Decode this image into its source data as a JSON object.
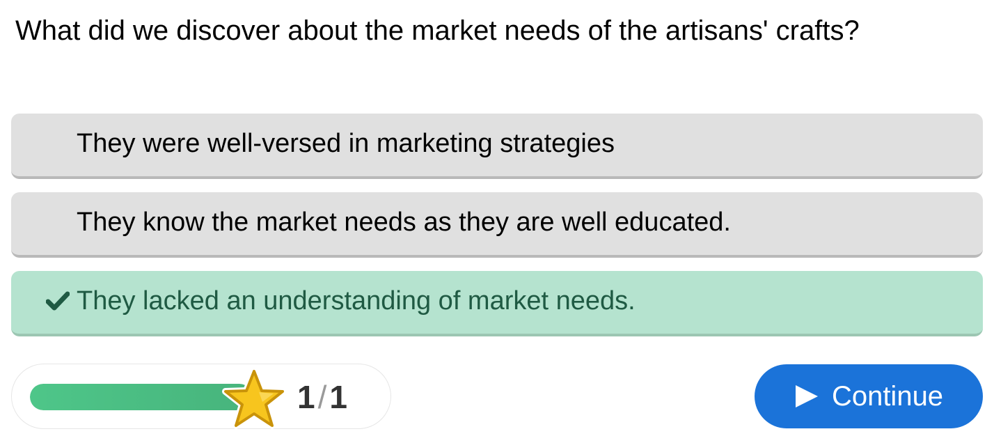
{
  "question": {
    "text": "What did we discover about the market needs of the artisans' crafts?"
  },
  "options": [
    {
      "label": "They were well-versed in marketing strategies",
      "state": "unselected"
    },
    {
      "label": "They know the market needs as they are well educated.",
      "state": "unselected"
    },
    {
      "label": "They lacked an understanding of market needs.",
      "state": "correct",
      "icon": "check-icon"
    }
  ],
  "progress": {
    "current": "1",
    "separator": "/",
    "total": "1",
    "fill_fraction": 1.0,
    "icon": "star-icon"
  },
  "continue_button": {
    "label": "Continue",
    "icon": "play-icon"
  },
  "colors": {
    "option_bg": "#e0e0e0",
    "correct_bg": "#b5e3cf",
    "correct_text": "#1f5a43",
    "progress_fill": "#4ec689",
    "button_bg": "#1b73d9",
    "star": "#f7c51e"
  }
}
